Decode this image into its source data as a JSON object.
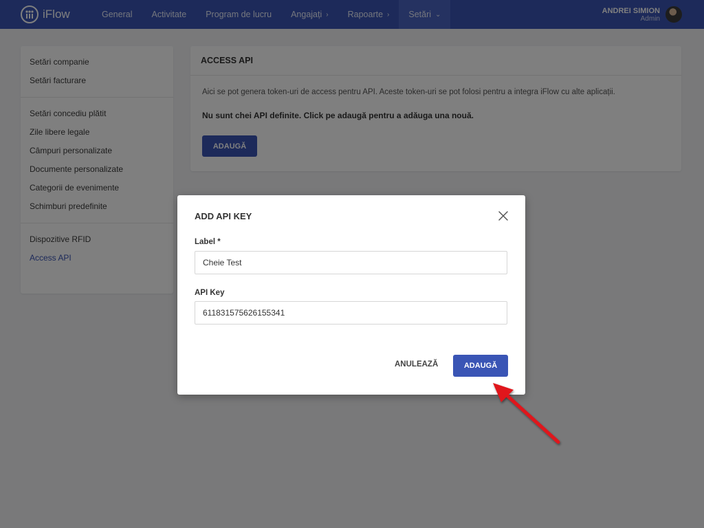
{
  "app": {
    "name": "iFlow",
    "brand_color": "#3a55b5"
  },
  "nav": {
    "items": [
      {
        "label": "General"
      },
      {
        "label": "Activitate"
      },
      {
        "label": "Program de lucru"
      },
      {
        "label": "Angajați",
        "chevron": "›"
      },
      {
        "label": "Rapoarte",
        "chevron": "›"
      },
      {
        "label": "Setări",
        "chevron": "⌄",
        "active": true
      }
    ]
  },
  "user": {
    "name": "ANDREI SIMION",
    "role": "Admin"
  },
  "sidebar": {
    "groups": [
      {
        "items": [
          {
            "label": "Setări companie"
          },
          {
            "label": "Setări facturare"
          }
        ]
      },
      {
        "items": [
          {
            "label": "Setări concediu plătit"
          },
          {
            "label": "Zile libere legale"
          },
          {
            "label": "Câmpuri personalizate"
          },
          {
            "label": "Documente personalizate"
          },
          {
            "label": "Categorii de evenimente"
          },
          {
            "label": "Schimburi predefinite"
          }
        ]
      },
      {
        "items": [
          {
            "label": "Dispozitive RFID"
          },
          {
            "label": "Access API",
            "active": true
          }
        ]
      }
    ]
  },
  "panel": {
    "title": "ACCESS API",
    "description": "Aici se pot genera token-uri de access pentru API. Aceste token-uri se pot folosi pentru a integra iFlow cu alte aplicații.",
    "empty_message": "Nu sunt chei API definite. Click pe adaugă pentru a adăuga una nouă.",
    "add_label": "ADAUGĂ"
  },
  "modal": {
    "title": "ADD API KEY",
    "label_field": {
      "label": "Label *",
      "value": "Cheie Test"
    },
    "key_field": {
      "label": "API Key",
      "value": "611831575626155341"
    },
    "cancel_label": "ANULEAZĂ",
    "add_label": "ADAUGĂ",
    "close_icon": "close-icon"
  },
  "annotation": {
    "arrow_color": "#e0141b",
    "points_to": "modal-add-button"
  }
}
